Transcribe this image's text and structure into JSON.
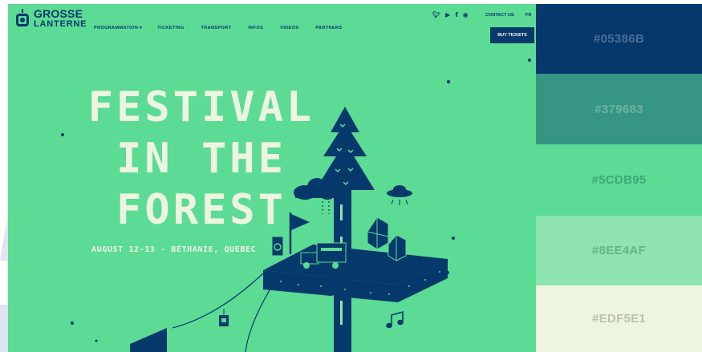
{
  "site": {
    "logo": {
      "line1": "GROSSE",
      "line2": "LANTERNE"
    },
    "nav": [
      "PROGRAMMATION ▾",
      "TICKETING",
      "TRANSPORT",
      "INFOS",
      "VIDEOS",
      "PARTNERS"
    ],
    "social_icons": [
      "twitter-icon",
      "youtube-icon",
      "facebook-icon",
      "instagram-icon"
    ],
    "contact": "CONTACT US",
    "language": "FR",
    "buy_button": "BUY TICKETS",
    "hero": {
      "line1": "FESTIVAL",
      "line2": "IN THE",
      "line3": "FOREST",
      "subtitle": "AUGUST 12-13 - BÉTHANIE, QUEBEC"
    }
  },
  "palette": [
    {
      "hex": "#05386B",
      "color": "#05386b",
      "text_color": "#4a6e95"
    },
    {
      "hex": "#379683",
      "color": "#379683",
      "text_color": "#6bb3a3"
    },
    {
      "hex": "#5CDB95",
      "color": "#5cdb95",
      "text_color": "#3fa877"
    },
    {
      "hex": "#8EE4AF",
      "color": "#8ee4af",
      "text_color": "#62b885"
    },
    {
      "hex": "#EDF5E1",
      "color": "#edf5e1",
      "text_color": "#b8c2ad"
    }
  ],
  "colors": {
    "navy": "#05386b",
    "teal": "#379683",
    "green": "#5cdb95",
    "light_green": "#8ee4af",
    "cream": "#edf5e1"
  }
}
